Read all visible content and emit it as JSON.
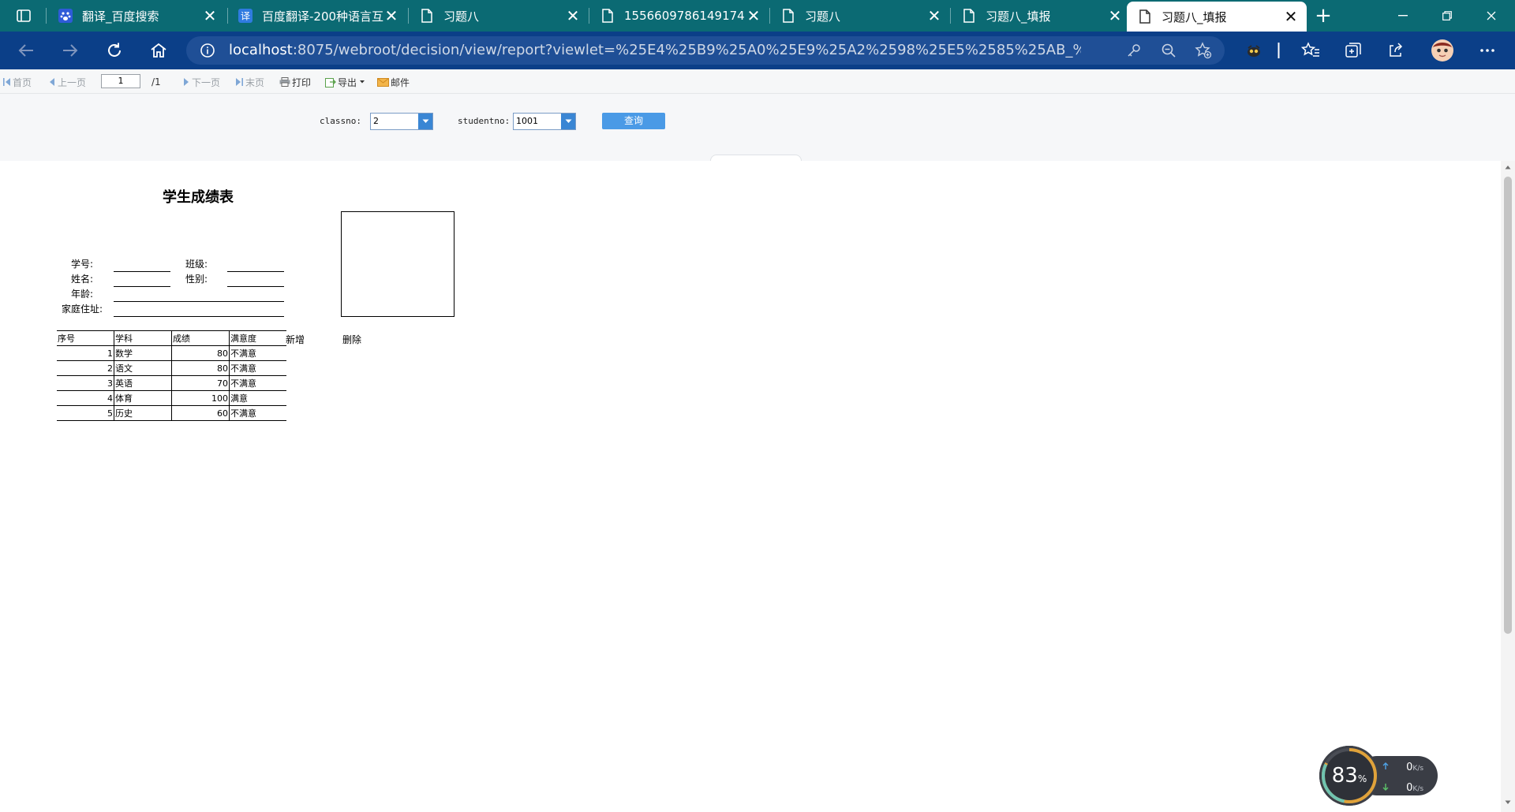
{
  "tabs": [
    {
      "title": "翻译_百度搜索",
      "icon": "baidu-paw-icon"
    },
    {
      "title": "百度翻译-200种语言互",
      "icon": "translate-icon"
    },
    {
      "title": "习题八",
      "icon": "page-icon"
    },
    {
      "title": "1556609786149174",
      "icon": "page-icon"
    },
    {
      "title": "习题八",
      "icon": "page-icon"
    },
    {
      "title": "习题八_填报",
      "icon": "page-icon"
    },
    {
      "title": "习题八_填报",
      "icon": "page-icon",
      "active": true
    }
  ],
  "tab_close_glyph": "✕",
  "new_tab_glyph": "+",
  "address": {
    "host": "localhost",
    "rest": ":8075/webroot/decision/view/report?viewlet=%25E4%25B9%25A0%25E9%25A2%2598%25E5%2585%25AB_%25E5%25A1%25AB%25..."
  },
  "report_toolbar": {
    "first": "首页",
    "prev": "上一页",
    "page_value": "1",
    "page_total": "/1",
    "next": "下一页",
    "last": "末页",
    "print": "打印",
    "export": "导出",
    "mail": "邮件"
  },
  "params": {
    "classno_label": "classno:",
    "classno_value": "2",
    "studentno_label": "studentno:",
    "studentno_value": "1001",
    "query_label": "查询"
  },
  "report": {
    "title": "学生成绩表",
    "fields": {
      "student_no": "学号:",
      "class": "班级:",
      "name": "姓名:",
      "gender": "性别:",
      "age": "年龄:",
      "address": "家庭住址:"
    },
    "add_label": "新增",
    "delete_label": "删除",
    "table": {
      "headers": [
        "序号",
        "学科",
        "成绩",
        "满意度"
      ],
      "rows": [
        [
          "1",
          "数学",
          "80",
          "不满意"
        ],
        [
          "2",
          "语文",
          "80",
          "不满意"
        ],
        [
          "3",
          "英语",
          "70",
          "不满意"
        ],
        [
          "4",
          "体育",
          "100",
          "满意"
        ],
        [
          "5",
          "历史",
          "60",
          "不满意"
        ]
      ]
    }
  },
  "net_widget": {
    "percent": "83",
    "percent_unit": "%",
    "upload_value": "0",
    "download_value": "0",
    "unit": "K/s"
  },
  "colors": {
    "tabbar": "#0b6a73",
    "navbar": "#0b3f88",
    "query_button": "#4a9ae6"
  }
}
